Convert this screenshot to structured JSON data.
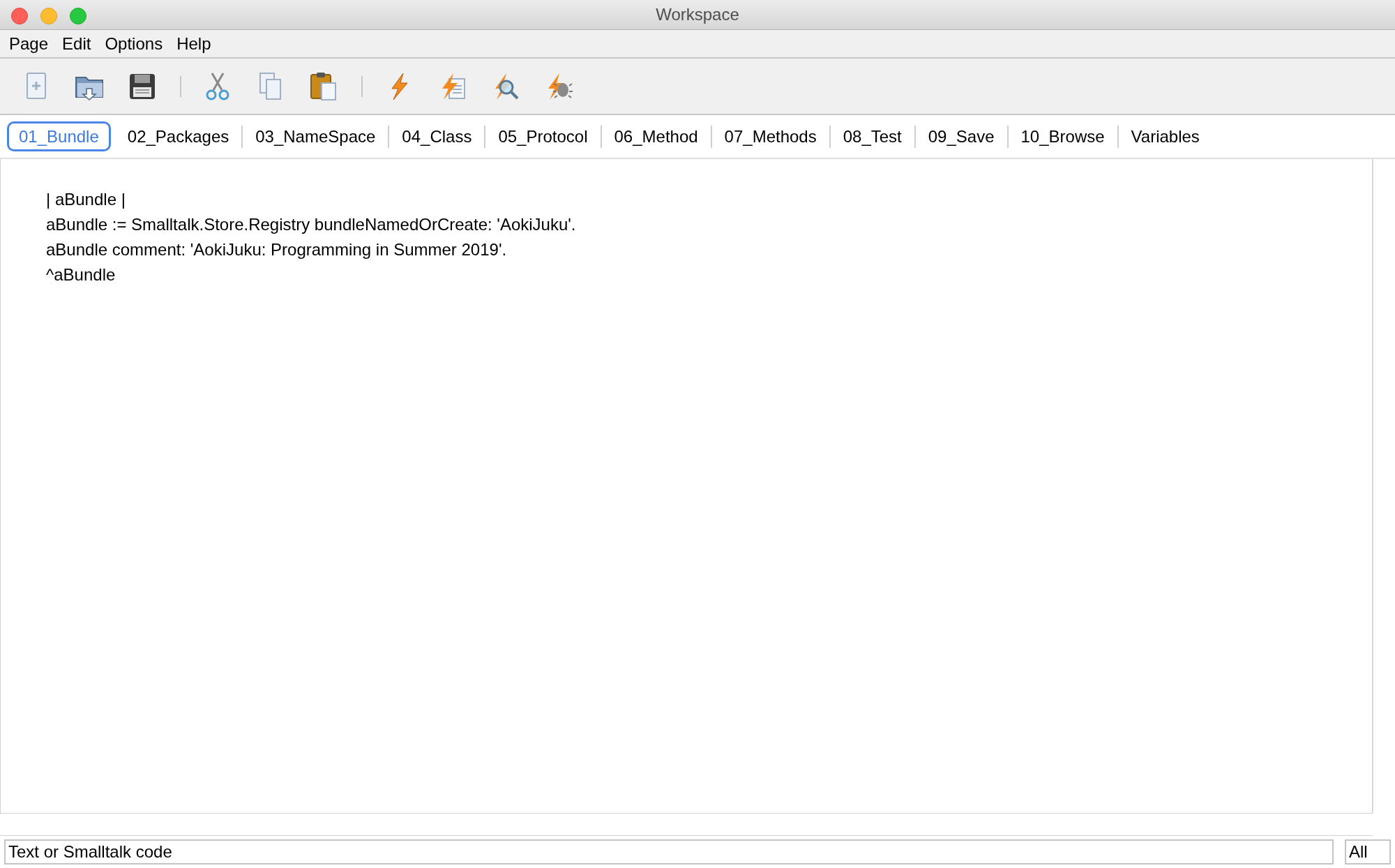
{
  "window": {
    "title": "Workspace"
  },
  "menu": [
    "Page",
    "Edit",
    "Options",
    "Help"
  ],
  "tabs": [
    {
      "label": "01_Bundle",
      "selected": true
    },
    {
      "label": "02_Packages",
      "selected": false
    },
    {
      "label": "03_NameSpace",
      "selected": false
    },
    {
      "label": "04_Class",
      "selected": false
    },
    {
      "label": "05_Protocol",
      "selected": false
    },
    {
      "label": "06_Method",
      "selected": false
    },
    {
      "label": "07_Methods",
      "selected": false
    },
    {
      "label": "08_Test",
      "selected": false
    },
    {
      "label": "09_Save",
      "selected": false
    },
    {
      "label": "10_Browse",
      "selected": false
    },
    {
      "label": "Variables",
      "selected": false
    }
  ],
  "editor": {
    "lines": [
      "| aBundle |",
      "aBundle := Smalltalk.Store.Registry bundleNamedOrCreate: 'AokiJuku'.",
      "aBundle comment: 'AokiJuku: Programming in Summer 2019'.",
      "^aBundle"
    ]
  },
  "search": {
    "value": "Text or Smalltalk code",
    "scope": "All"
  }
}
